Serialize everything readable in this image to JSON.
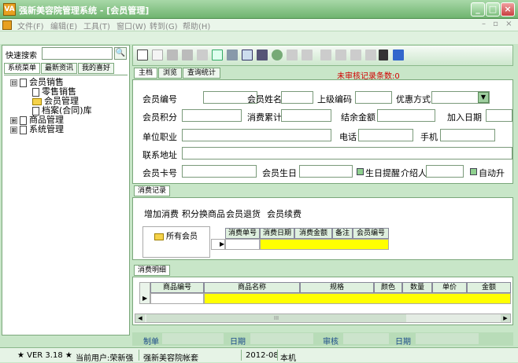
{
  "title": "强新美容院管理系统  -  [会员管理]",
  "app_icon": "VA",
  "menu": [
    "文件(F)",
    "编辑(E)",
    "工具(T)",
    "窗口(W)",
    "转到(G)",
    "帮助(H)"
  ],
  "window_controls": [
    "_",
    "□",
    "×"
  ],
  "mdi_controls": "– ▫ ×",
  "left": {
    "quick_search_label": "快速搜索",
    "tabs": [
      "系统菜单",
      "最新资讯",
      "我的喜好"
    ],
    "tree": [
      {
        "label": "会员销售",
        "exp": "⊟"
      },
      {
        "label": "零售销售"
      },
      {
        "label": "会员管理"
      },
      {
        "label": "档案(合同)库"
      },
      {
        "label": "商品管理",
        "exp": "⊞"
      },
      {
        "label": "系统管理",
        "exp": "⊞"
      }
    ]
  },
  "tabs": [
    "主档",
    "浏览",
    "查询统计"
  ],
  "unaudited_text": "未审核记录条数:0",
  "form": {
    "member_no": "会员编号",
    "member_name": "会员姓名",
    "upper_code": "上级编码",
    "discount": "优惠方式",
    "points": "会员积分",
    "consume_total": "消费累计",
    "balance": "结余金额",
    "join_date": "加入日期",
    "company": "单位职业",
    "phone": "电话",
    "mobile": "手机",
    "address": "联系地址",
    "card_no": "会员卡号",
    "birthday": "会员生日",
    "bday_remind": "生日提醒",
    "referrer": "介绍人",
    "auto": "自动升"
  },
  "consume": {
    "tab": "消费记录",
    "actions": [
      "增加消费",
      "积分换商品",
      "会员退货",
      "会员续费"
    ],
    "all_members": "所有会员",
    "columns": [
      "消费单号",
      "消费日期",
      "消费金额",
      "备注",
      "会员编号"
    ]
  },
  "detail": {
    "tab": "消费明细",
    "columns": [
      "商品编号",
      "商品名称",
      "规格",
      "颜色",
      "数量",
      "单价",
      "金额"
    ],
    "scroll_mark": "III"
  },
  "footer": {
    "maker": "制单",
    "date1": "日期",
    "audit": "审核",
    "date2": "日期"
  },
  "status": {
    "version": "★ VER 3.18 ★",
    "user": "当前用户:荣新强",
    "account": "强新美容院帐套",
    "period": "2012-08",
    "mode": "本机"
  },
  "colors": {
    "accent": "#6fb46f",
    "highlight": "#ffff00",
    "warning": "#d00000"
  }
}
